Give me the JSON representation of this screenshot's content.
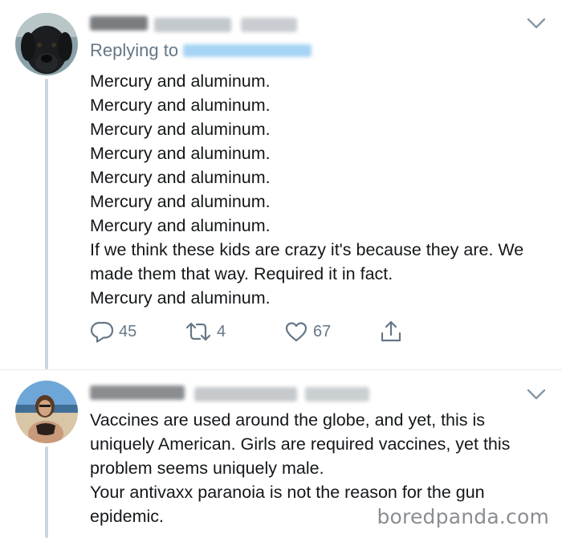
{
  "tweets": [
    {
      "replying_label": "Replying to",
      "lines": [
        "Mercury and aluminum.",
        "Mercury and aluminum.",
        "Mercury and aluminum.",
        "Mercury and aluminum.",
        "Mercury and aluminum.",
        "Mercury and aluminum.",
        "Mercury and aluminum.",
        "If we think these kids are crazy it's because they are. We",
        "made them that way. Required it in fact.",
        "Mercury and aluminum."
      ],
      "actions": {
        "replies": "45",
        "retweets": "4",
        "likes": "67"
      },
      "icons": [
        "reply-icon",
        "retweet-icon",
        "like-icon",
        "share-icon",
        "chevron-down-icon"
      ]
    },
    {
      "lines": [
        "Vaccines are used around the globe, and yet, this is",
        "uniquely American. Girls are required vaccines, yet this",
        "problem seems uniquely male.",
        "Your antivaxx paranoia is not the reason for the gun",
        "epidemic."
      ],
      "icons": [
        "chevron-down-icon"
      ]
    }
  ],
  "watermark": "boredpanda.com",
  "colors": {
    "text": "#14171a",
    "secondary": "#657786",
    "thread_line": "#ccd6dd",
    "divider": "#e6ecf0",
    "link_blur": "#a7d4f4"
  }
}
